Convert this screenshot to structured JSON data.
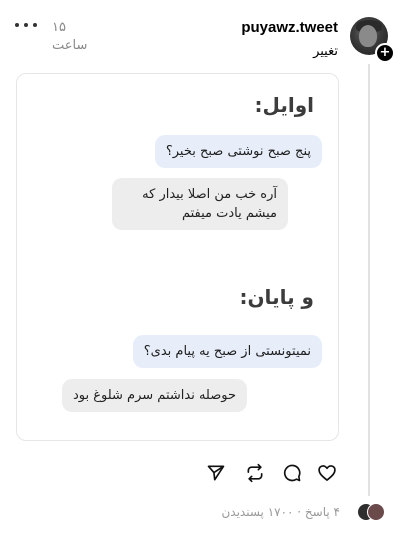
{
  "post": {
    "username": "puyawz.tweet",
    "time": "۱۵ ساعت",
    "caption": "تغییر"
  },
  "image": {
    "heading_first": "اوایل:",
    "msg1_sent": "پنج صبح نوشتی صبح بخیر؟",
    "msg2_reply": "آره خب من اصلا بیدار که میشم یادت میفتم",
    "heading_last": "و پایان:",
    "msg3_sent": "نمیتونستی از صبح یه پیام بدی؟",
    "msg4_reply": "حوصله نداشتم سرم شلوغ بود"
  },
  "actions": {
    "icons": [
      "heart-icon",
      "comment-icon",
      "repost-icon",
      "share-icon"
    ]
  },
  "footer": {
    "stats": "۴ پاسخ · ۱۷۰۰ پسندیدن"
  }
}
